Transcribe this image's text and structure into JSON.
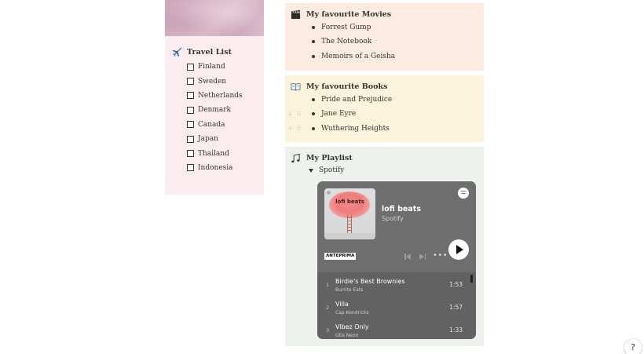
{
  "travel": {
    "title": "Travel  List",
    "icon": "airplane-icon",
    "items": [
      "Finland",
      "Sweden",
      "Netherlands",
      "Denmark",
      "Canada",
      "Japan",
      "Thailand",
      "Indonesia"
    ]
  },
  "movies": {
    "title": "My favourite Movies",
    "icon": "clapperboard-icon",
    "items": [
      "Forrest Gump",
      "The Notebook",
      "Memoirs of a Geisha"
    ]
  },
  "books": {
    "title": "My favourite Books",
    "icon": "open-book-icon",
    "items": [
      "Pride and Prejudice",
      "Jane Eyre",
      "Wuthering Heights"
    ]
  },
  "playlist": {
    "title": "My Playlist",
    "icon": "music-notes-icon",
    "toggle_label": "Spotify",
    "embed": {
      "album_art_text": "lofi beats",
      "playlist_name": "lofi beats",
      "provider": "Spotify",
      "badge": "ANTEPRIMA",
      "tracks": [
        {
          "num": "1",
          "title": "Birdie's Best Brownies",
          "artist": "Burrito Eats",
          "duration": "1:53"
        },
        {
          "num": "2",
          "title": "Villa",
          "artist": "Cap Kendricks",
          "duration": "1:57"
        },
        {
          "num": "3",
          "title": "Vibez Only",
          "artist": "Otis Neon",
          "duration": "1:33"
        }
      ]
    }
  },
  "help": {
    "label": "?"
  },
  "colors": {
    "movies_bg": "#fbebe0",
    "books_bg": "#fbf3db",
    "playlist_bg": "#edf3ec",
    "travel_bg": "#fbecf0",
    "spotify_bg": "#6b6b6b"
  }
}
